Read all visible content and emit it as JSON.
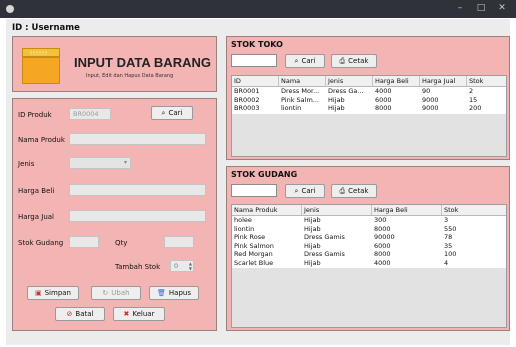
{
  "user": {
    "label": "ID : Username"
  },
  "header": {
    "title": "INPUT DATA BARANG",
    "subtitle": "Input, Edit dan Hapus Data Barang"
  },
  "form": {
    "id_produk": {
      "label": "ID Produk",
      "value": "BR0004"
    },
    "cari_label": "Cari",
    "nama_produk": {
      "label": "Nama Produk",
      "value": ""
    },
    "jenis": {
      "label": "Jenis",
      "value": ""
    },
    "harga_beli": {
      "label": "Harga Beli",
      "value": ""
    },
    "harga_jual": {
      "label": "Harga Jual",
      "value": ""
    },
    "stok_gudang": {
      "label": "Stok Gudang",
      "value": ""
    },
    "qty": {
      "label": "Qty",
      "value": ""
    },
    "tambah_stok": {
      "label": "Tambah Stok",
      "value": "0"
    },
    "buttons": {
      "simpan": "Simpan",
      "ubah": "Ubah",
      "hapus": "Hapus",
      "batal": "Batal",
      "keluar": "Keluar"
    }
  },
  "stok_toko": {
    "title": "STOK TOKO",
    "cari_label": "Cari",
    "cetak_label": "Cetak",
    "columns": [
      "ID",
      "Nama",
      "Jenis",
      "Harga Beli",
      "Harga Jual",
      "Stok"
    ],
    "rows": [
      [
        "BR0001",
        "Dress Mor...",
        "Dress Ga...",
        "4000",
        "90",
        "2"
      ],
      [
        "BR0002",
        "Pink Salm...",
        "Hijab",
        "6000",
        "9000",
        "15"
      ],
      [
        "BR0003",
        "liontin",
        "Hijab",
        "8000",
        "9000",
        "200"
      ]
    ]
  },
  "stok_gudang": {
    "title": "STOK GUDANG",
    "cari_label": "Cari",
    "cetak_label": "Cetak",
    "columns": [
      "Nama Produk",
      "Jenis",
      "Harga Beli",
      "Stok"
    ],
    "rows": [
      [
        "holee",
        "Hijab",
        "300",
        "3"
      ],
      [
        "liontin",
        "Hijab",
        "8000",
        "550"
      ],
      [
        "Pink Rose",
        "Dress Gamis",
        "90000",
        "78"
      ],
      [
        "Pink Salmon",
        "Hijab",
        "6000",
        "35"
      ],
      [
        "Red Morgan",
        "Dress Gamis",
        "8000",
        "100"
      ],
      [
        "Scarlet Blue",
        "Hijab",
        "4000",
        "4"
      ]
    ]
  },
  "colors": {
    "panel": "#f3b4b4",
    "accent_logo": "#f5a623"
  }
}
